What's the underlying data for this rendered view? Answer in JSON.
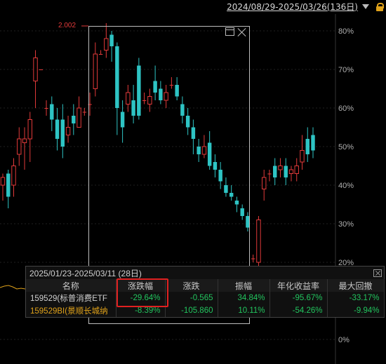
{
  "header": {
    "date_range": "2024/08/29-2025/03/26(136日)",
    "dropdown_icon": "chevron-down-icon",
    "lock_icon": "lock-icon"
  },
  "chart_data": {
    "type": "candlestick",
    "y_axis_labels": [
      "80%",
      "70%",
      "60%",
      "50%",
      "40%",
      "30%",
      "20%",
      "0%"
    ],
    "y_axis_values": [
      80,
      70,
      60,
      50,
      40,
      30,
      20,
      0
    ],
    "ylim": [
      0,
      83
    ],
    "max_marker": "2.002",
    "up_color": "#e23a3a",
    "down_color": "#2ec4c4",
    "candles": [
      {
        "o": 40,
        "c": 42,
        "h": 43,
        "l": 36
      },
      {
        "o": 43,
        "c": 37,
        "h": 44,
        "l": 34
      },
      {
        "o": 40,
        "c": 45,
        "h": 47,
        "l": 37
      },
      {
        "o": 48,
        "c": 52,
        "h": 55,
        "l": 45
      },
      {
        "o": 51,
        "c": 52,
        "h": 55,
        "l": 44
      },
      {
        "o": 52,
        "c": 57,
        "h": 59,
        "l": 46
      },
      {
        "o": 67,
        "c": 73,
        "h": 75,
        "l": 60
      },
      {
        "o": 70,
        "c": 70,
        "h": 70,
        "l": 70
      },
      {
        "o": 60,
        "c": 60,
        "h": 62,
        "l": 58
      },
      {
        "o": 61,
        "c": 57,
        "h": 63,
        "l": 54
      },
      {
        "o": 57,
        "c": 52,
        "h": 60,
        "l": 49
      },
      {
        "o": 57,
        "c": 50,
        "h": 61,
        "l": 47
      },
      {
        "o": 53,
        "c": 55,
        "h": 58,
        "l": 51
      },
      {
        "o": 58,
        "c": 56,
        "h": 61,
        "l": 53
      },
      {
        "o": 55,
        "c": 60,
        "h": 63,
        "l": 55
      },
      {
        "o": 59,
        "c": 59,
        "h": 60,
        "l": 58
      },
      {
        "o": 61,
        "c": 61,
        "h": 64,
        "l": 58
      },
      {
        "o": 65,
        "c": 74,
        "h": 77,
        "l": 63
      },
      {
        "o": 74,
        "c": 74,
        "h": 75,
        "l": 74
      },
      {
        "o": 75,
        "c": 78,
        "h": 82,
        "l": 73
      },
      {
        "o": 79,
        "c": 76,
        "h": 80,
        "l": 72
      },
      {
        "o": 76,
        "c": 60,
        "h": 77,
        "l": 53
      },
      {
        "o": 59,
        "c": 55,
        "h": 62,
        "l": 51
      },
      {
        "o": 61,
        "c": 64,
        "h": 66,
        "l": 59
      },
      {
        "o": 62,
        "c": 58,
        "h": 66,
        "l": 56
      },
      {
        "o": 71,
        "c": 58,
        "h": 73,
        "l": 57
      },
      {
        "o": 62,
        "c": 62,
        "h": 64,
        "l": 61
      },
      {
        "o": 61,
        "c": 63,
        "h": 65,
        "l": 59
      },
      {
        "o": 67,
        "c": 64,
        "h": 71,
        "l": 62
      },
      {
        "o": 65,
        "c": 62,
        "h": 67,
        "l": 61
      },
      {
        "o": 62,
        "c": 64,
        "h": 66,
        "l": 60
      },
      {
        "o": 66,
        "c": 66,
        "h": 68,
        "l": 65
      },
      {
        "o": 66,
        "c": 63,
        "h": 68,
        "l": 62
      },
      {
        "o": 61,
        "c": 58,
        "h": 63,
        "l": 56
      },
      {
        "o": 58,
        "c": 55,
        "h": 60,
        "l": 53
      },
      {
        "o": 55,
        "c": 52,
        "h": 57,
        "l": 48
      },
      {
        "o": 50,
        "c": 48,
        "h": 52,
        "l": 46
      },
      {
        "o": 48,
        "c": 50,
        "h": 53,
        "l": 47
      },
      {
        "o": 51,
        "c": 45,
        "h": 54,
        "l": 44
      },
      {
        "o": 46,
        "c": 44,
        "h": 48,
        "l": 42
      },
      {
        "o": 44,
        "c": 41,
        "h": 46,
        "l": 39
      },
      {
        "o": 40,
        "c": 38,
        "h": 42,
        "l": 37
      },
      {
        "o": 38,
        "c": 37,
        "h": 40,
        "l": 36
      },
      {
        "o": 36,
        "c": 35,
        "h": 37,
        "l": 33
      },
      {
        "o": 34,
        "c": 32,
        "h": 35,
        "l": 31
      },
      {
        "o": 32,
        "c": 29,
        "h": 33,
        "l": 28
      },
      {
        "o": 21,
        "c": 21,
        "h": 22,
        "l": 20
      },
      {
        "o": 20,
        "c": 31,
        "h": 32,
        "l": 18
      },
      {
        "o": 39,
        "c": 42,
        "h": 44,
        "l": 36
      },
      {
        "o": 43,
        "c": 43,
        "h": 44,
        "l": 41
      },
      {
        "o": 45,
        "c": 42,
        "h": 47,
        "l": 40
      },
      {
        "o": 44,
        "c": 45,
        "h": 47,
        "l": 42
      },
      {
        "o": 45,
        "c": 42,
        "h": 47,
        "l": 40
      },
      {
        "o": 43,
        "c": 44,
        "h": 45,
        "l": 41
      },
      {
        "o": 43,
        "c": 45,
        "h": 47,
        "l": 41
      },
      {
        "o": 46,
        "c": 49,
        "h": 53,
        "l": 44
      },
      {
        "o": 52,
        "c": 48,
        "h": 55,
        "l": 46
      },
      {
        "o": 53,
        "c": 49,
        "h": 55,
        "l": 47
      }
    ]
  },
  "selection": {
    "window_icon": "window-icon",
    "close_icon": "close-icon"
  },
  "panel": {
    "title": "2025/01/23-2025/03/11 (28日)",
    "headers": [
      "名称",
      "涨跌幅",
      "涨跌",
      "振幅",
      "年化收益率",
      "最大回撤"
    ],
    "rows": [
      {
        "name": "159529(标普消费ETF",
        "pct": "-29.64%",
        "chg": "-0.565",
        "amp": "34.84%",
        "annual": "-95.67%",
        "drawdown": "-33.17%"
      },
      {
        "name": "159529BI(景顺长城纳",
        "pct": "-8.39%",
        "chg": "-105.860",
        "amp": "10.11%",
        "annual": "-54.26%",
        "drawdown": "-9.94%"
      }
    ]
  }
}
